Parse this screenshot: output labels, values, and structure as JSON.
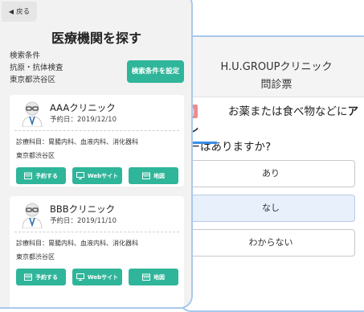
{
  "search": {
    "back_label": "戻る",
    "title": "医療機関を探す",
    "conditions_heading": "検索条件",
    "condition_test": "抗原・抗体検査",
    "condition_area": "東京都渋谷区",
    "set_button": "検索条件を設定"
  },
  "clinics": [
    {
      "name": "AAAクリニック",
      "reservation_date": "予約日：2019/12/10",
      "departments": "診療科目：胃腸内科、血液内科、消化器科",
      "area": "東京都渋谷区",
      "reserve_label": "予約する",
      "website_label": "Webサイト",
      "map_label": "地図"
    },
    {
      "name": "BBBクリニック",
      "reservation_date": "予約日：2019/11/10",
      "departments": "診療科目：胃腸内科、血液内科、消化器科",
      "area": "東京都渋谷区",
      "reserve_label": "予約する",
      "website_label": "Webサイト",
      "map_label": "地図"
    }
  ],
  "questionnaire": {
    "clinic_name": "H.U.GROUPクリニック",
    "title": "問診票",
    "required_badge": "必須",
    "question_part1": "お薬または食べ物などに",
    "question_bold": "アレ",
    "question_part2": "ギーはありますか?",
    "options": [
      "あり",
      "なし",
      "わからない"
    ],
    "selected_option": "なし"
  },
  "colors": {
    "accent_green": "#2fb59a",
    "frame_blue": "#a9c8ee",
    "progress_blue": "#3a8ee6",
    "required_red": "#f08a8a"
  }
}
